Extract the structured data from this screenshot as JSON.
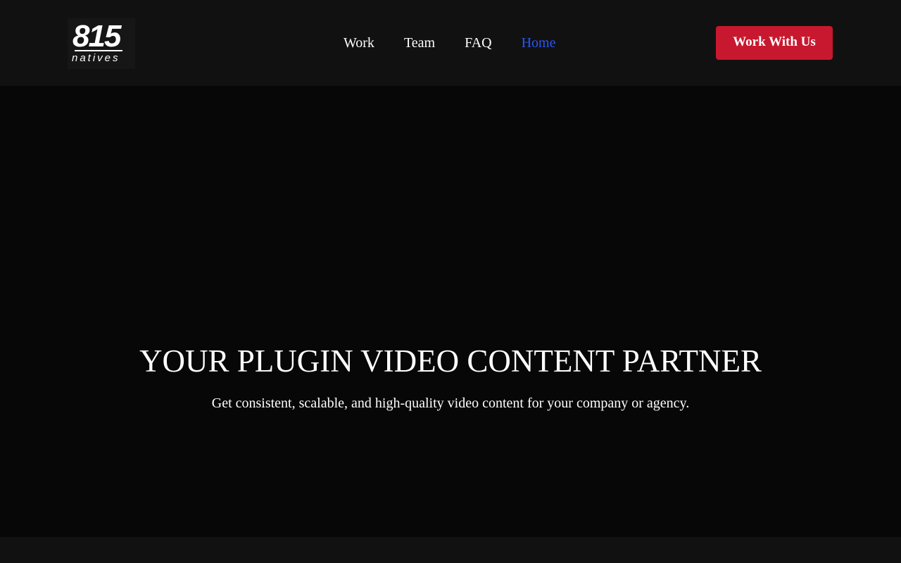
{
  "header": {
    "logo": {
      "number": "815",
      "word": "natives"
    },
    "nav": [
      {
        "label": "Work",
        "active": false
      },
      {
        "label": "Team",
        "active": false
      },
      {
        "label": "FAQ",
        "active": false
      },
      {
        "label": "Home",
        "active": true
      }
    ],
    "cta_label": "Work With Us"
  },
  "hero": {
    "title": "YOUR PLUGIN VIDEO CONTENT PARTNER",
    "subtitle": "Get consistent, scalable, and high-quality video content for your company or agency."
  },
  "colors": {
    "header_bg": "#111111",
    "hero_bg": "#070707",
    "accent_red": "#c8182f",
    "active_link": "#2b56f5",
    "text": "#ffffff"
  }
}
